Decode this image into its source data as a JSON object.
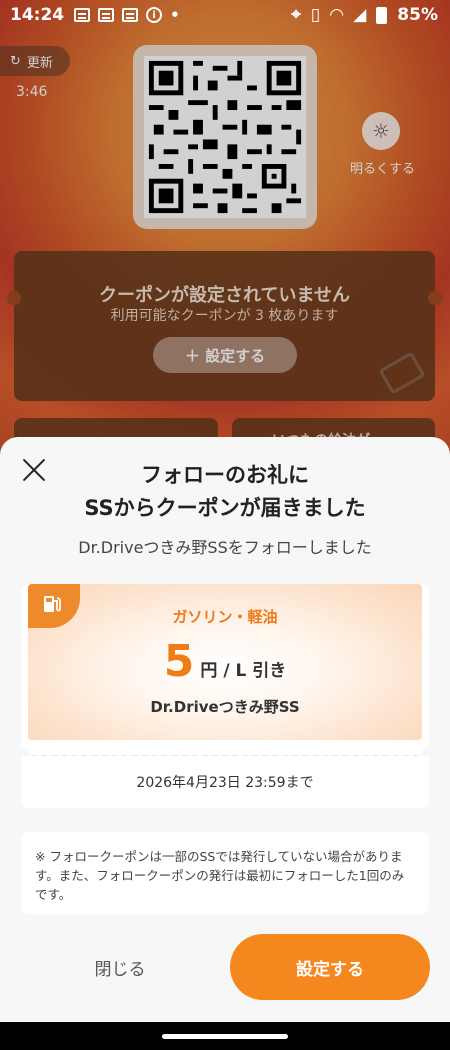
{
  "status_bar": {
    "time": "14:24",
    "info_icon": "i",
    "dot": "•",
    "battery": "85%"
  },
  "background": {
    "refresh_label": "更新",
    "timer": "3:46",
    "brightness_label": "明るくする",
    "coupon_card": {
      "title": "クーポンが設定されていません",
      "subtitle": "利用可能なクーポンが 3 枚あります",
      "button_label": "＋ 設定する"
    },
    "mini_card_text": "いつもの給油が"
  },
  "sheet": {
    "title_line1": "フォローのお礼に",
    "title_line2": "SSからクーポンが届きました",
    "subtitle": "Dr.Driveつきみ野SSをフォローしました",
    "coupon": {
      "fuel_type": "ガソリン・軽油",
      "amount": "5",
      "unit": "円 / L 引き",
      "ss_name": "Dr.Driveつきみ野SS",
      "expiry": "2026年4月23日 23:59まで"
    },
    "note": "※ フォロークーポンは一部のSSでは発行していない場合があります。また、フォロークーポンの発行は最初にフォローした1回のみです。",
    "close_label": "閉じる",
    "set_label": "設定する"
  },
  "colors": {
    "accent": "#f5871f",
    "coupon_orange": "#ef7d16"
  }
}
